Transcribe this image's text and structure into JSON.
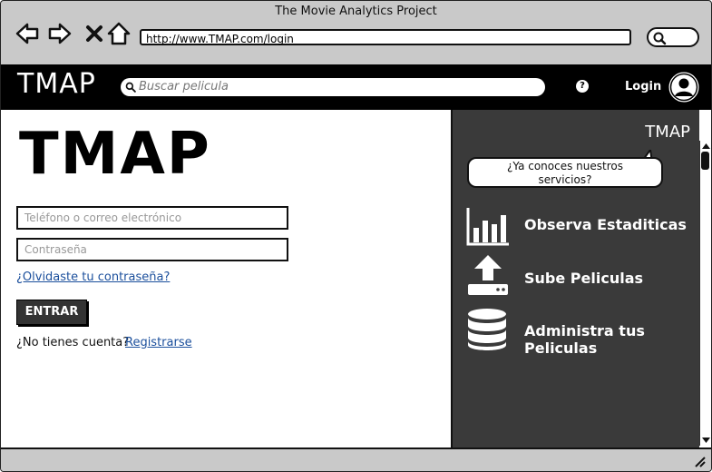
{
  "window": {
    "title": "The Movie Analytics Project"
  },
  "browser": {
    "url": "http://www.TMAP.com/login"
  },
  "appbar": {
    "brand": "TMAP",
    "search_placeholder": "Buscar pelicula",
    "help_glyph": "?",
    "login_label": "Login"
  },
  "login": {
    "logo": "TMAP",
    "phone_email_placeholder": "Teléfono o correo electrónico",
    "password_placeholder": "Contraseña",
    "forgot_link": "¿Olvidaste tu contraseña?",
    "submit_label": "ENTRAR",
    "no_account_text": "¿No tienes cuenta?",
    "register_link": "Registrarse"
  },
  "panel": {
    "title": "TMAP",
    "bubble_line1": "¿Ya conoces nuestros",
    "bubble_line2": "servicios?",
    "features": [
      {
        "label": "Observa Estaditicas",
        "icon": "bar-chart-icon"
      },
      {
        "label": "Sube Peliculas",
        "icon": "upload-icon"
      },
      {
        "label": "Administra tus Peliculas",
        "icon": "database-icon"
      }
    ]
  },
  "colors": {
    "appbar": "#000000",
    "panel": "#3a3a3a",
    "link": "#1b4f9c",
    "button": "#333333"
  }
}
